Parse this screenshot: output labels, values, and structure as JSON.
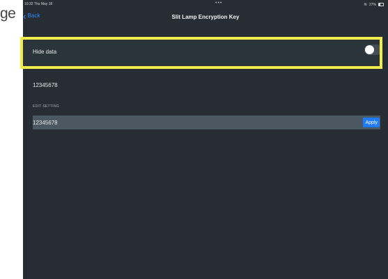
{
  "crop_text": "ge",
  "status_bar": {
    "time": "10:32  Thu May 18",
    "dots": "•••",
    "battery_pct": "27%"
  },
  "nav": {
    "back_label": "Back",
    "title": "Slit Lamp Encryption Key"
  },
  "hide_row": {
    "label": "Hide data",
    "toggle_on": false
  },
  "plain_value": "12345678",
  "section_header": "EDIT SETTING",
  "edit": {
    "value": "12345678",
    "apply_label": "Apply"
  },
  "colors": {
    "background": "#262d34",
    "accent": "#2d8cff",
    "apply": "#1e7bff",
    "highlight": "#f2ec4b"
  }
}
